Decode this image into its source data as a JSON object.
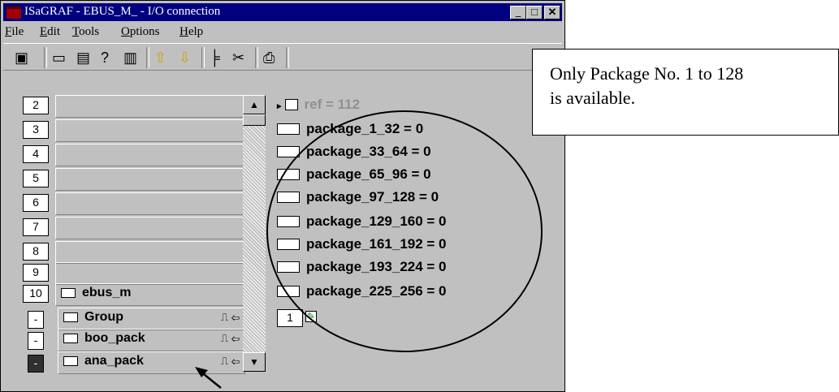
{
  "window": {
    "title": "ISaGRAF - EBUS_M_ - I/O connection",
    "controls": [
      "_",
      "□",
      "✕"
    ]
  },
  "menu": [
    "File",
    "Edit",
    "Tools",
    "Options",
    "Help"
  ],
  "menu_hotkeys": [
    "F",
    "E",
    "T",
    "O",
    "H"
  ],
  "slots": [
    {
      "num": "2",
      "label": ""
    },
    {
      "num": "3",
      "label": ""
    },
    {
      "num": "4",
      "label": ""
    },
    {
      "num": "5",
      "label": ""
    },
    {
      "num": "6",
      "label": ""
    },
    {
      "num": "7",
      "label": ""
    },
    {
      "num": "8",
      "label": ""
    },
    {
      "num": "9",
      "label": ""
    },
    {
      "num": "10",
      "label": "ebus_m"
    }
  ],
  "sub_boards": [
    {
      "marker": "-",
      "label": "Group"
    },
    {
      "marker": "-",
      "label": "boo_pack"
    },
    {
      "marker": "-",
      "label": "ana_pack"
    }
  ],
  "variables": {
    "ref": "ref = 112",
    "packages": [
      "package_1_32 = 0",
      "package_33_64 = 0",
      "package_65_96 = 0",
      "package_97_128 = 0",
      "package_129_160 = 0",
      "package_161_192 = 0",
      "package_193_224 = 0",
      "package_225_256 = 0"
    ],
    "channel_index": "1"
  },
  "callout": {
    "line1": "Only Package No. 1 to 128",
    "line2": "is available."
  },
  "icons": [
    "app-icon",
    "minimize-icon",
    "maximize-icon",
    "close-icon",
    "page-setup-icon",
    "board-icon",
    "module-icon",
    "help-icon",
    "delete-icon",
    "up-arrow-icon",
    "down-arrow-icon",
    "tree-icon",
    "cut-icon",
    "print-icon"
  ]
}
